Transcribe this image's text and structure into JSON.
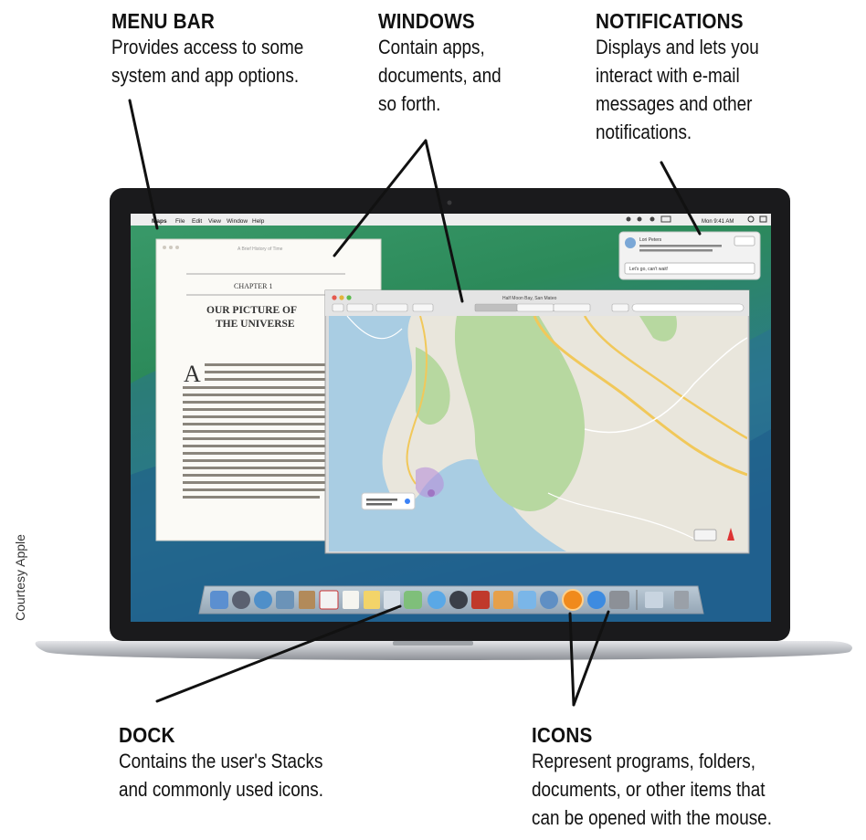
{
  "callouts": {
    "menu_bar": {
      "title": "MENU BAR",
      "lines": [
        "Provides access to some",
        "system and app options."
      ]
    },
    "windows": {
      "title": "WINDOWS",
      "lines": [
        "Contain apps,",
        "documents, and",
        "so forth."
      ]
    },
    "notifications": {
      "title": "NOTIFICATIONS",
      "lines": [
        "Displays and lets you",
        "interact with e-mail",
        "messages and other",
        "notifications."
      ]
    },
    "dock": {
      "title": "DOCK",
      "lines": [
        "Contains the user's Stacks",
        "and commonly used icons."
      ]
    },
    "icons": {
      "title": "ICONS",
      "lines": [
        "Represent programs, folders,",
        "documents, or other items that",
        "can be opened with the mouse."
      ]
    }
  },
  "credit": "Courtesy Apple",
  "screen": {
    "menubar": {
      "apple": "",
      "items": [
        "Maps",
        "File",
        "Edit",
        "View",
        "Window",
        "Help"
      ],
      "clock": "Mon 9:41 AM"
    },
    "book": {
      "chapter": "CHAPTER 1",
      "title_line1": "OUR PICTURE OF",
      "title_line2": "THE UNIVERSE",
      "drop_cap": "A",
      "header": "A Brief History of Time"
    },
    "map": {
      "title": "Half Moon Bay, San Mateo"
    },
    "notification": {
      "sender": "Lori Peters",
      "reply_placeholder": "Let's go, can't wait!"
    }
  },
  "colors": {
    "desktop_top": "#2c8a5a",
    "desktop_bottom": "#1f5f8f",
    "map_land": "#e9e6dc",
    "map_park": "#b7d8a0",
    "map_water": "#a9cde3"
  }
}
